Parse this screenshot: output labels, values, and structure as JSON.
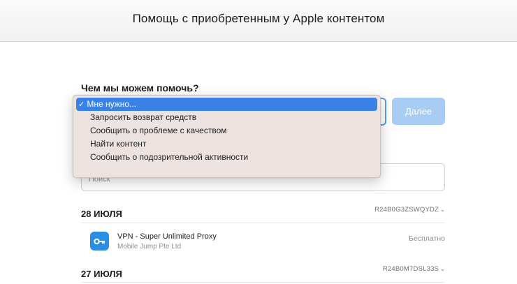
{
  "header": {
    "title": "Помощь с приобретенным у Apple контентом"
  },
  "form": {
    "question": "Чем мы можем помочь?",
    "next_label": "Далее",
    "search_placeholder": "Поиск"
  },
  "dropdown": {
    "selected_check": "✓",
    "options": [
      "Мне нужно...",
      "Запросить возврат средств",
      "Сообщить о проблеме с качеством",
      "Найти контент",
      "Сообщить о подозрительной активности"
    ]
  },
  "purchases": [
    {
      "date": "28 ИЮЛЯ",
      "order_id": "R24B0G3ZSWQYDZ",
      "items": [
        {
          "name": "VPN - Super Unlimited Proxy",
          "developer": "Mobile Jump Pte Ltd",
          "price": "Бесплатно",
          "icon": "key-icon"
        }
      ]
    },
    {
      "date": "27 ИЮЛЯ",
      "order_id": "R24B0M7DSL33S",
      "items": []
    }
  ],
  "icons": {
    "chevron": "⌄"
  },
  "colors": {
    "accent": "#3b82e6",
    "next_button": "#a8cdf5",
    "app_icon": "#2b8ee6"
  }
}
